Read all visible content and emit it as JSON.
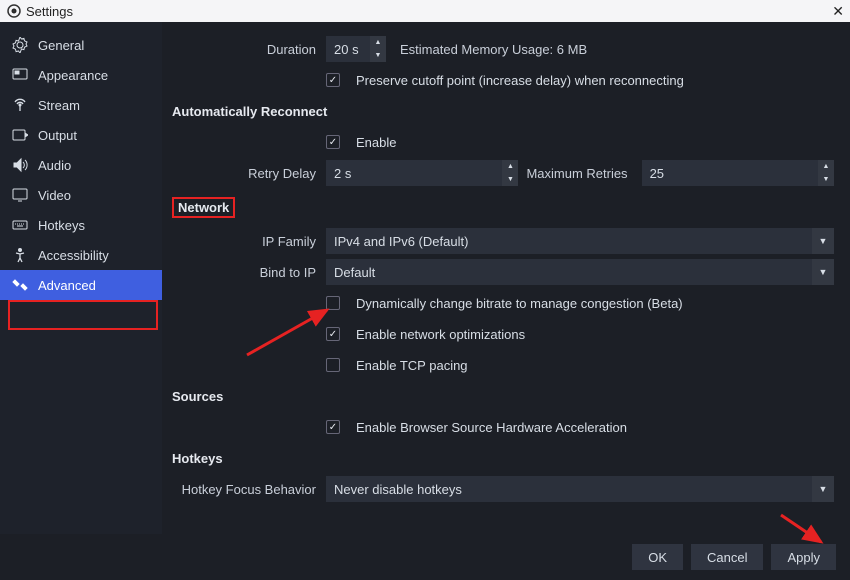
{
  "window": {
    "title": "Settings"
  },
  "sidebar": {
    "items": [
      {
        "label": "General"
      },
      {
        "label": "Appearance"
      },
      {
        "label": "Stream"
      },
      {
        "label": "Output"
      },
      {
        "label": "Audio"
      },
      {
        "label": "Video"
      },
      {
        "label": "Hotkeys"
      },
      {
        "label": "Accessibility"
      },
      {
        "label": "Advanced"
      }
    ]
  },
  "top": {
    "duration_label": "Duration",
    "duration_value": "20 s",
    "est_usage": "Estimated Memory Usage: 6 MB",
    "preserve_label": "Preserve cutoff point (increase delay) when reconnecting"
  },
  "reconnect": {
    "title": "Automatically Reconnect",
    "enable_label": "Enable",
    "retry_delay_label": "Retry Delay",
    "retry_delay_value": "2 s",
    "max_retries_label": "Maximum Retries",
    "max_retries_value": "25"
  },
  "network": {
    "title": "Network",
    "ip_family_label": "IP Family",
    "ip_family_value": "IPv4 and IPv6 (Default)",
    "bind_ip_label": "Bind to IP",
    "bind_ip_value": "Default",
    "dyn_bitrate_label": "Dynamically change bitrate to manage congestion (Beta)",
    "net_opt_label": "Enable network optimizations",
    "tcp_pacing_label": "Enable TCP pacing"
  },
  "sources": {
    "title": "Sources",
    "browser_hw_label": "Enable Browser Source Hardware Acceleration"
  },
  "hotkeys": {
    "title": "Hotkeys",
    "focus_label": "Hotkey Focus Behavior",
    "focus_value": "Never disable hotkeys"
  },
  "buttons": {
    "ok": "OK",
    "cancel": "Cancel",
    "apply": "Apply"
  }
}
